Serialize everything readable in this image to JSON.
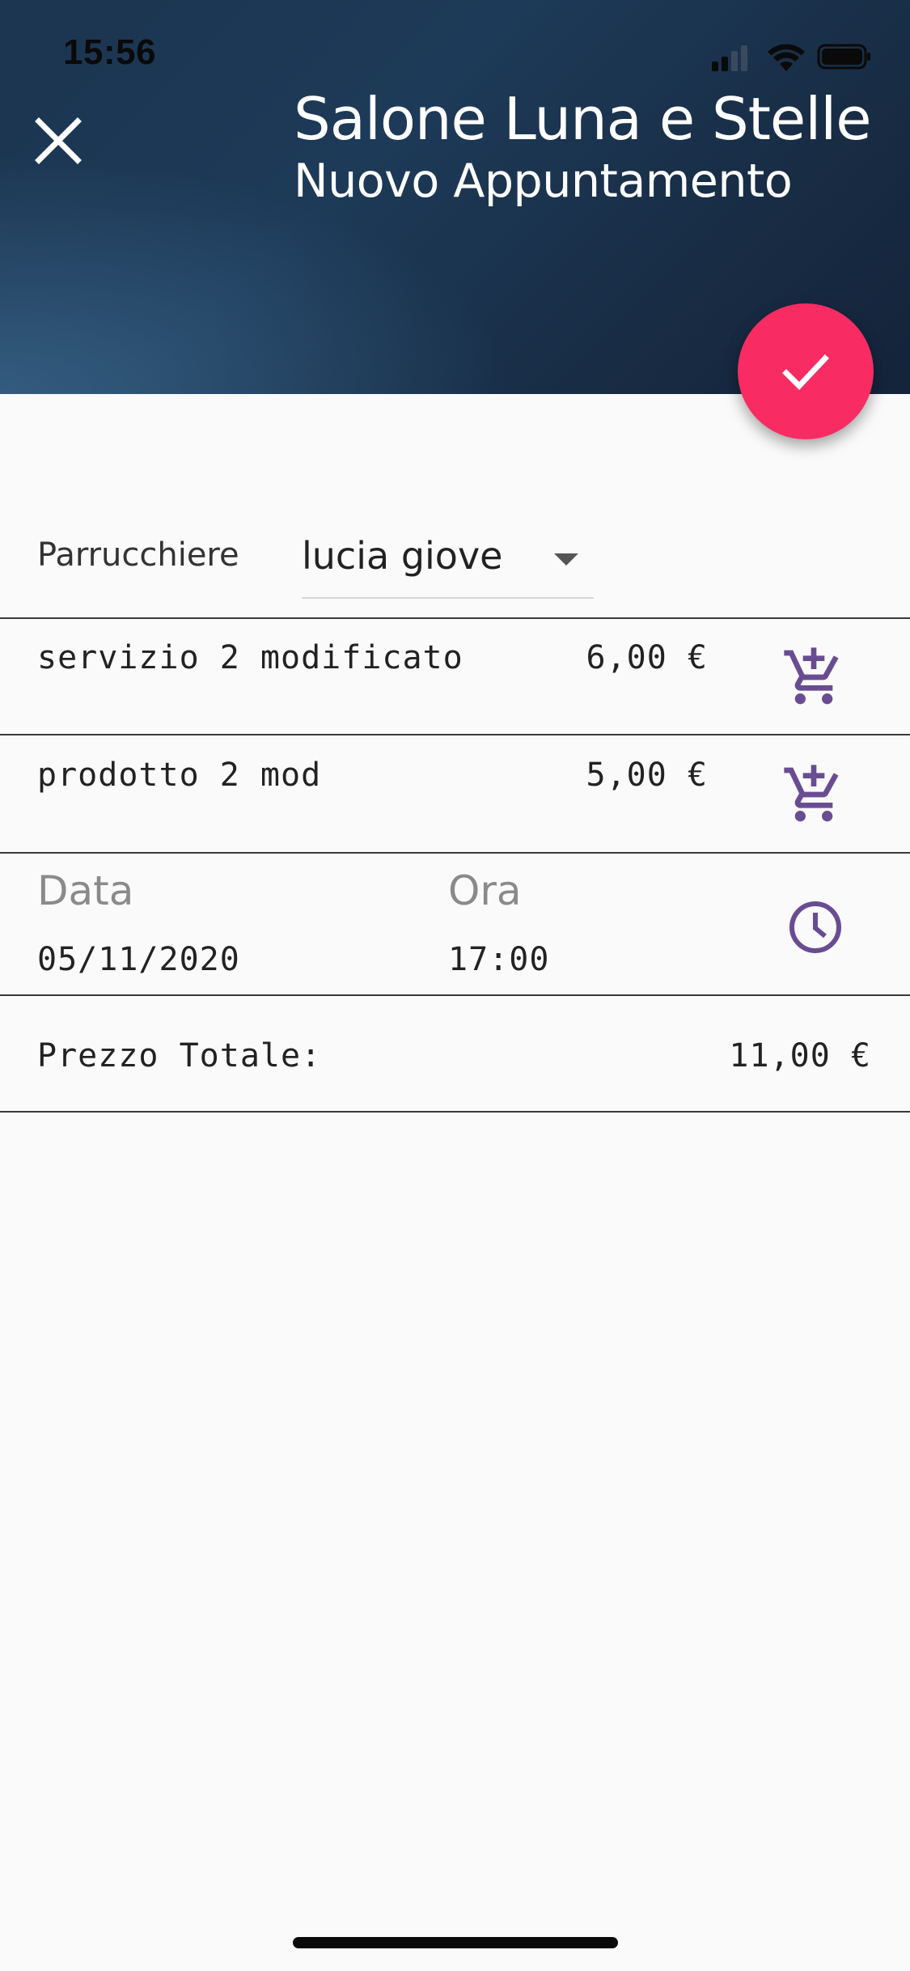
{
  "status_bar": {
    "time": "15:56"
  },
  "header": {
    "title": "Salone Luna e Stelle",
    "subtitle": "Nuovo Appuntamento",
    "close_icon": "close-icon",
    "background_color": "#1d3a58"
  },
  "fab": {
    "icon": "check-icon",
    "color": "#f82b63"
  },
  "form": {
    "hairdresser_label": "Parrucchiere",
    "hairdresser_value": "lucia giove"
  },
  "items": [
    {
      "name": "servizio 2 modificato",
      "price": "6,00 €",
      "icon": "add-shopping-cart-icon"
    },
    {
      "name": "prodotto 2 mod",
      "price": "5,00 €",
      "icon": "add-shopping-cart-icon"
    }
  ],
  "datetime": {
    "date_label": "Data",
    "date_value": "05/11/2020",
    "time_label": "Ora",
    "time_value": "17:00",
    "icon": "clock-icon"
  },
  "total": {
    "label": "Prezzo Totale:",
    "value": "11,00 €"
  },
  "colors": {
    "accent": "#f82b63",
    "icon_purple": "#6a4c93",
    "divider": "#3a3a3a"
  }
}
